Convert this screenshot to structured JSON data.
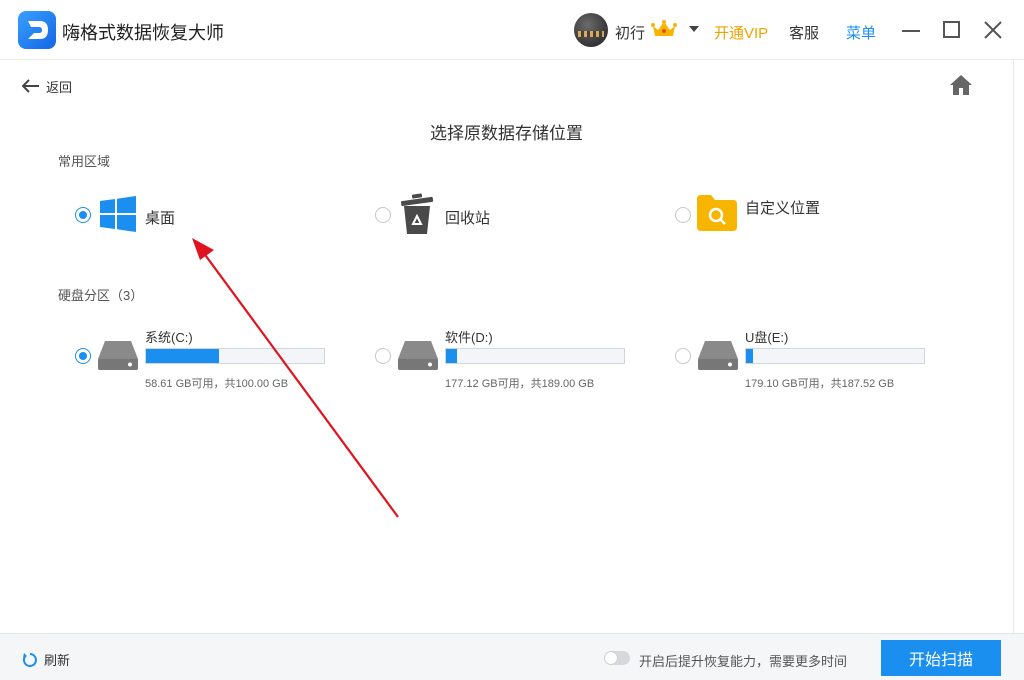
{
  "app": {
    "title": "嗨格式数据恢复大师",
    "accent": "#1b8ff0"
  },
  "header": {
    "username": "初行",
    "vip_label": "开通VIP",
    "service_label": "客服",
    "menu_label": "菜单",
    "vip_color": "#f0a200"
  },
  "nav": {
    "back_label": "返回"
  },
  "main": {
    "title": "选择原数据存储位置",
    "common_section": "常用区域",
    "disk_section": "硬盘分区（3）",
    "locations": [
      {
        "label": "桌面",
        "icon": "windows-icon",
        "selected": true
      },
      {
        "label": "回收站",
        "icon": "recycle-bin-icon",
        "selected": false
      },
      {
        "label": "自定义位置",
        "icon": "folder-search-icon",
        "selected": false
      }
    ],
    "drives": [
      {
        "name": "系统(C:)",
        "capacity": "58.61 GB可用，共100.00 GB",
        "used_fraction": 0.41,
        "selected": true
      },
      {
        "name": "软件(D:)",
        "capacity": "177.12 GB可用，共189.00 GB",
        "used_fraction": 0.06,
        "selected": false
      },
      {
        "name": "U盘(E:)",
        "capacity": "179.10 GB可用，共187.52 GB",
        "used_fraction": 0.04,
        "selected": false
      }
    ]
  },
  "footer": {
    "refresh_label": "刷新",
    "toggle_text": "开启后提升恢复能力，需要更多时间",
    "toggle_on": false,
    "start_label": "开始扫描"
  }
}
